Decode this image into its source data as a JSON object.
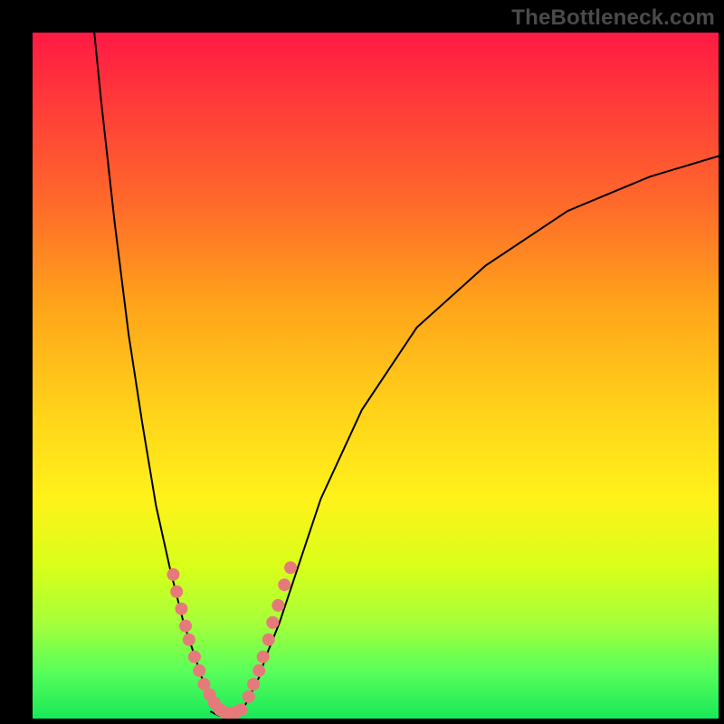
{
  "watermark": {
    "text": "TheBottleneck.com"
  },
  "chart_data": {
    "type": "line",
    "title": "",
    "xlabel": "",
    "ylabel": "",
    "xlim": [
      0,
      100
    ],
    "ylim": [
      0,
      100
    ],
    "grid": false,
    "legend": false,
    "series": [
      {
        "name": "left-branch",
        "x": [
          9,
          10,
          12,
          14,
          16,
          18,
          20,
          21,
          22,
          23,
          24,
          25,
          26,
          27,
          28
        ],
        "y": [
          100,
          90,
          72,
          56,
          43,
          31,
          22,
          18,
          14,
          11,
          8,
          5,
          3,
          2,
          1
        ]
      },
      {
        "name": "right-branch",
        "x": [
          30,
          31,
          32,
          33,
          34,
          36,
          38,
          42,
          48,
          56,
          66,
          78,
          90,
          100
        ],
        "y": [
          1,
          2,
          4,
          6,
          9,
          14,
          20,
          32,
          45,
          57,
          66,
          74,
          79,
          82
        ]
      },
      {
        "name": "valley-floor",
        "x": [
          26,
          27,
          28,
          29,
          30,
          31
        ],
        "y": [
          1,
          0.5,
          0.3,
          0.3,
          0.5,
          1
        ]
      }
    ],
    "dot_series": [
      {
        "name": "dots-left",
        "points": [
          {
            "x": 20.5,
            "y": 21
          },
          {
            "x": 21.0,
            "y": 18.5
          },
          {
            "x": 21.7,
            "y": 16
          },
          {
            "x": 22.3,
            "y": 13.5
          },
          {
            "x": 22.8,
            "y": 11.5
          },
          {
            "x": 23.6,
            "y": 9
          },
          {
            "x": 24.3,
            "y": 7
          },
          {
            "x": 25.0,
            "y": 5
          },
          {
            "x": 25.8,
            "y": 3.5
          },
          {
            "x": 26.5,
            "y": 2.3
          }
        ]
      },
      {
        "name": "dots-right",
        "points": [
          {
            "x": 31.5,
            "y": 3.2
          },
          {
            "x": 32.2,
            "y": 5
          },
          {
            "x": 33.0,
            "y": 7
          },
          {
            "x": 33.6,
            "y": 9
          },
          {
            "x": 34.4,
            "y": 11.5
          },
          {
            "x": 35.0,
            "y": 14
          },
          {
            "x": 35.8,
            "y": 16.5
          },
          {
            "x": 36.7,
            "y": 19.5
          },
          {
            "x": 37.6,
            "y": 22
          }
        ]
      },
      {
        "name": "dots-floor",
        "points": [
          {
            "x": 27.3,
            "y": 1.3
          },
          {
            "x": 28.0,
            "y": 0.9
          },
          {
            "x": 28.8,
            "y": 0.8
          },
          {
            "x": 29.6,
            "y": 0.9
          },
          {
            "x": 30.4,
            "y": 1.3
          }
        ]
      }
    ],
    "colors": {
      "curve": "#000000",
      "dots": "#e67a7a",
      "gradient_top": "#ff1a44",
      "gradient_bottom": "#18e858"
    }
  }
}
